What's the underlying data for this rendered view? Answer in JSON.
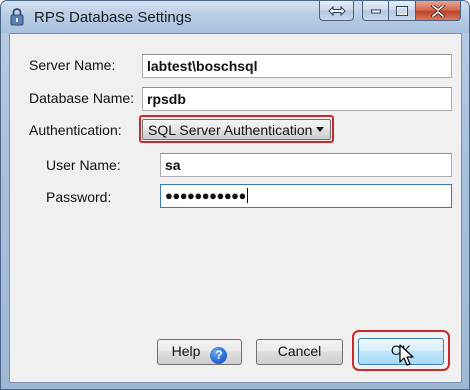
{
  "window": {
    "title": "RPS Database Settings"
  },
  "form": {
    "server_name_label": "Server Name:",
    "server_name_value": "labtest\\boschsql",
    "database_name_label": "Database Name:",
    "database_name_value": "rpsdb",
    "authentication_label": "Authentication:",
    "authentication_value": "SQL Server Authentication",
    "user_name_label": "User Name:",
    "user_name_value": "sa",
    "password_label": "Password:",
    "password_value": "●●●●●●●●●●●"
  },
  "buttons": {
    "help_label": "Help",
    "help_glyph": "?",
    "cancel_label": "Cancel",
    "ok_label": "OK"
  },
  "colors": {
    "highlight": "#c62b2b",
    "default_button_border": "#3c7fb1"
  },
  "icons": {
    "window": "lock-icon",
    "restore": "restore-arrows-icon",
    "minimize": "minimize-icon",
    "maximize": "maximize-icon",
    "close": "close-icon",
    "help": "question-icon",
    "pointer": "mouse-pointer-icon"
  }
}
